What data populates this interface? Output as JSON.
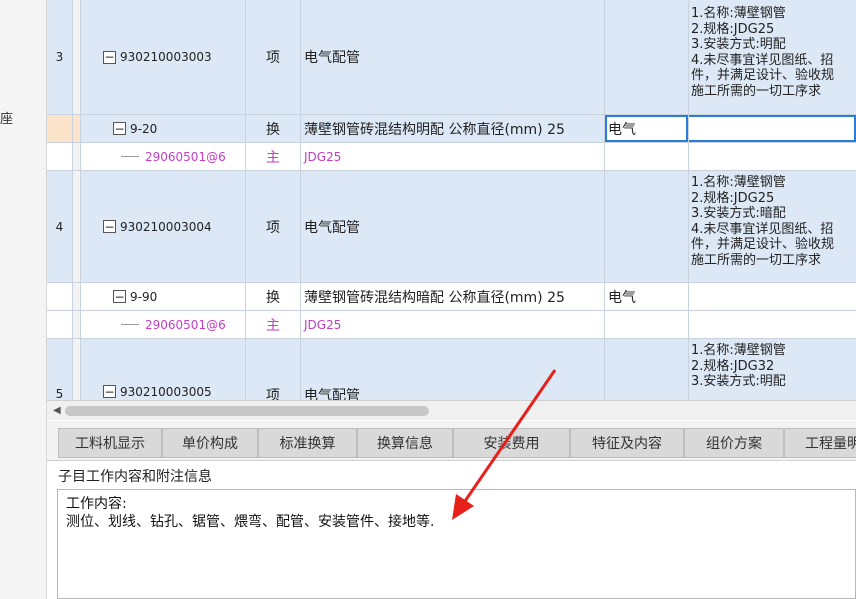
{
  "sidebar": {
    "fragment": "座"
  },
  "grid": {
    "rows": [
      {
        "num": "3",
        "code": "930210003003",
        "type": "项",
        "name": "电气配管",
        "spec": "",
        "desc": "1.名称:薄壁钢管\n2.规格:JDG25\n3.安装方式:明配\n4.未尽事宜详见图纸、招\n件，并满足设计、验收规\n施工所需的一切工序求"
      },
      {
        "num": "",
        "code": "9-20",
        "type": "换",
        "name": "薄壁钢管砖混结构明配 公称直径(mm) 25",
        "spec": "电气",
        "desc": ""
      },
      {
        "num": "",
        "code": "29060501@6",
        "type": "主",
        "name": "JDG25",
        "spec": "",
        "desc": ""
      },
      {
        "num": "4",
        "code": "930210003004",
        "type": "项",
        "name": "电气配管",
        "spec": "",
        "desc": "1.名称:薄壁钢管\n2.规格:JDG25\n3.安装方式:暗配\n4.未尽事宜详见图纸、招\n件，并满足设计、验收规\n施工所需的一切工序求"
      },
      {
        "num": "",
        "code": "9-90",
        "type": "换",
        "name": "薄壁钢管砖混结构暗配 公称直径(mm) 25",
        "spec": "电气",
        "desc": ""
      },
      {
        "num": "",
        "code": "29060501@6",
        "type": "主",
        "name": "JDG25",
        "spec": "",
        "desc": ""
      },
      {
        "num": "5",
        "code": "930210003005",
        "type": "项",
        "name": "电气配管",
        "spec": "",
        "desc": "1.名称:薄壁钢管\n2.规格:JDG32\n3.安装方式:明配"
      }
    ]
  },
  "tabs": [
    "工料机显示",
    "单价构成",
    "标准换算",
    "换算信息",
    "安装费用",
    "特征及内容",
    "组价方案",
    "工程量明"
  ],
  "info": {
    "title": "子目工作内容和附注信息",
    "content": "工作内容:\n测位、划线、钻孔、锯管、煨弯、配管、安装管件、接地等."
  },
  "colors": {
    "selected_border": "#2b7bdc",
    "item_row_bg": "#dde8f6",
    "annotation_arrow": "#e8201c",
    "material_text": "#c23fc2"
  }
}
